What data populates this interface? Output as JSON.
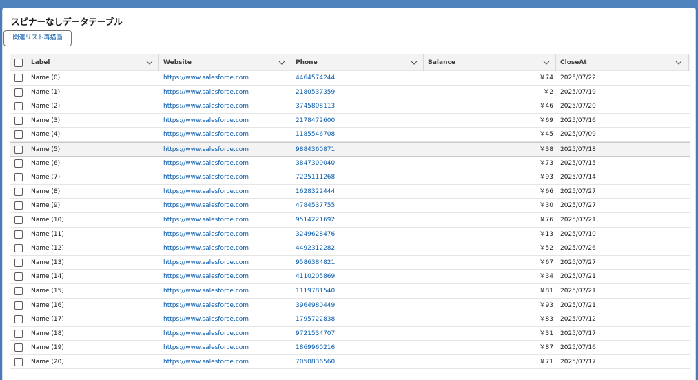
{
  "card": {
    "title": "スピナーなしデータテーブル",
    "redraw_label": "関連リスト再描画"
  },
  "columns": [
    {
      "label": "Label"
    },
    {
      "label": "Website"
    },
    {
      "label": "Phone"
    },
    {
      "label": "Balance"
    },
    {
      "label": "CloseAt"
    }
  ],
  "rows": [
    {
      "label": "Name (0)",
      "website": "https://www.salesforce.com",
      "phone": "4464574244",
      "balance": "￥74",
      "close": "2025/07/22"
    },
    {
      "label": "Name (1)",
      "website": "https://www.salesforce.com",
      "phone": "2180537359",
      "balance": "￥2",
      "close": "2025/07/19"
    },
    {
      "label": "Name (2)",
      "website": "https://www.salesforce.com",
      "phone": "3745808113",
      "balance": "￥46",
      "close": "2025/07/20"
    },
    {
      "label": "Name (3)",
      "website": "https://www.salesforce.com",
      "phone": "2178472600",
      "balance": "￥69",
      "close": "2025/07/16"
    },
    {
      "label": "Name (4)",
      "website": "https://www.salesforce.com",
      "phone": "1185546708",
      "balance": "￥45",
      "close": "2025/07/09"
    },
    {
      "label": "Name (5)",
      "website": "https://www.salesforce.com",
      "phone": "9884360871",
      "balance": "￥38",
      "close": "2025/07/18"
    },
    {
      "label": "Name (6)",
      "website": "https://www.salesforce.com",
      "phone": "3847309040",
      "balance": "￥73",
      "close": "2025/07/15"
    },
    {
      "label": "Name (7)",
      "website": "https://www.salesforce.com",
      "phone": "7225111268",
      "balance": "￥93",
      "close": "2025/07/14"
    },
    {
      "label": "Name (8)",
      "website": "https://www.salesforce.com",
      "phone": "1628322444",
      "balance": "￥66",
      "close": "2025/07/27"
    },
    {
      "label": "Name (9)",
      "website": "https://www.salesforce.com",
      "phone": "4784537755",
      "balance": "￥30",
      "close": "2025/07/27"
    },
    {
      "label": "Name (10)",
      "website": "https://www.salesforce.com",
      "phone": "9514221692",
      "balance": "￥76",
      "close": "2025/07/21"
    },
    {
      "label": "Name (11)",
      "website": "https://www.salesforce.com",
      "phone": "3249628476",
      "balance": "￥13",
      "close": "2025/07/10"
    },
    {
      "label": "Name (12)",
      "website": "https://www.salesforce.com",
      "phone": "4492312282",
      "balance": "￥52",
      "close": "2025/07/26"
    },
    {
      "label": "Name (13)",
      "website": "https://www.salesforce.com",
      "phone": "9586384821",
      "balance": "￥67",
      "close": "2025/07/27"
    },
    {
      "label": "Name (14)",
      "website": "https://www.salesforce.com",
      "phone": "4110205869",
      "balance": "￥34",
      "close": "2025/07/21"
    },
    {
      "label": "Name (15)",
      "website": "https://www.salesforce.com",
      "phone": "1119781540",
      "balance": "￥81",
      "close": "2025/07/21"
    },
    {
      "label": "Name (16)",
      "website": "https://www.salesforce.com",
      "phone": "3964980449",
      "balance": "￥93",
      "close": "2025/07/21"
    },
    {
      "label": "Name (17)",
      "website": "https://www.salesforce.com",
      "phone": "1795722838",
      "balance": "￥83",
      "close": "2025/07/12"
    },
    {
      "label": "Name (18)",
      "website": "https://www.salesforce.com",
      "phone": "9721534707",
      "balance": "￥31",
      "close": "2025/07/17"
    },
    {
      "label": "Name (19)",
      "website": "https://www.salesforce.com",
      "phone": "1869960216",
      "balance": "￥87",
      "close": "2025/07/16"
    },
    {
      "label": "Name (20)",
      "website": "https://www.salesforce.com",
      "phone": "7050836560",
      "balance": "￥71",
      "close": "2025/07/17"
    }
  ],
  "highlighted_row": 5
}
